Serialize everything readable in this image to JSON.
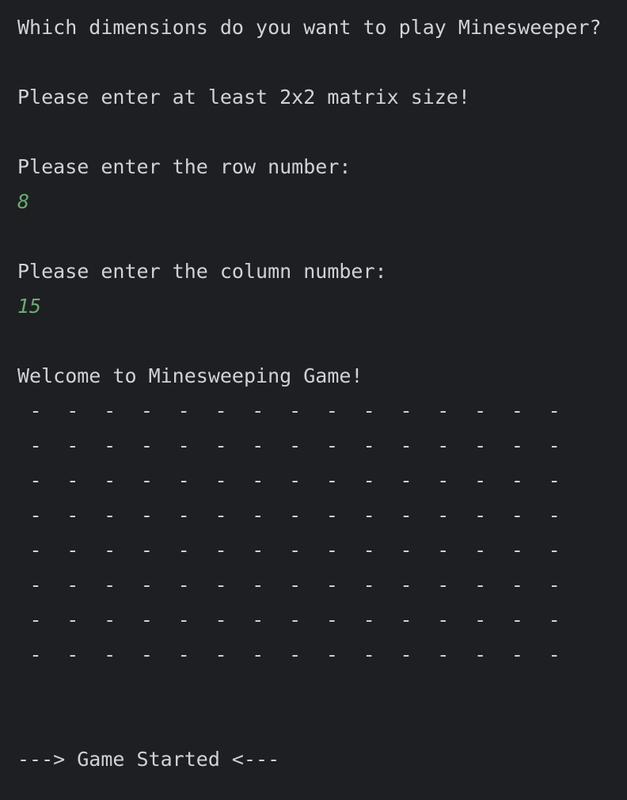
{
  "console": {
    "prompt_dimensions": "Which dimensions do you want to play Minesweeper?",
    "prompt_min_size": "Please enter at least 2x2 matrix size!",
    "prompt_row": "Please enter the row number:",
    "input_row": "8",
    "prompt_column": "Please enter the column number:",
    "input_column": "15",
    "welcome": "Welcome to Minesweeping Game!",
    "game_started": "---> Game Started <---"
  },
  "board": {
    "rows": 8,
    "columns": 15,
    "hidden_cell_symbol": "-"
  },
  "colors": {
    "background": "#1e1f22",
    "text": "#d0d2d6",
    "user_input": "#6aab73"
  }
}
